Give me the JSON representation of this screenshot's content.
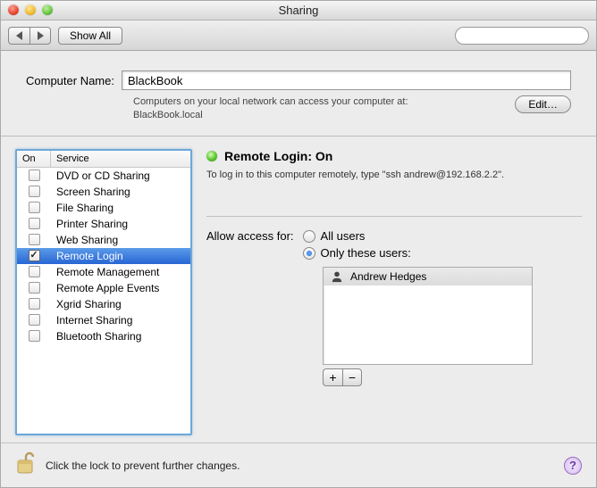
{
  "window": {
    "title": "Sharing"
  },
  "toolbar": {
    "show_all": "Show All",
    "search_placeholder": ""
  },
  "computer_name": {
    "label": "Computer Name:",
    "value": "BlackBook",
    "subtext_line1": "Computers on your local network can access your computer at:",
    "subtext_line2": "BlackBook.local",
    "edit": "Edit…"
  },
  "services": {
    "header_on": "On",
    "header_service": "Service",
    "items": [
      {
        "label": "DVD or CD Sharing",
        "on": false,
        "selected": false
      },
      {
        "label": "Screen Sharing",
        "on": false,
        "selected": false
      },
      {
        "label": "File Sharing",
        "on": false,
        "selected": false
      },
      {
        "label": "Printer Sharing",
        "on": false,
        "selected": false
      },
      {
        "label": "Web Sharing",
        "on": false,
        "selected": false
      },
      {
        "label": "Remote Login",
        "on": true,
        "selected": true
      },
      {
        "label": "Remote Management",
        "on": false,
        "selected": false
      },
      {
        "label": "Remote Apple Events",
        "on": false,
        "selected": false
      },
      {
        "label": "Xgrid Sharing",
        "on": false,
        "selected": false
      },
      {
        "label": "Internet Sharing",
        "on": false,
        "selected": false
      },
      {
        "label": "Bluetooth Sharing",
        "on": false,
        "selected": false
      }
    ]
  },
  "detail": {
    "status_title": "Remote Login: On",
    "status_desc": "To log in to this computer remotely, type \"ssh andrew@192.168.2.2\".",
    "access_label": "Allow access for:",
    "radio_all": "All users",
    "radio_only": "Only these users:",
    "users": [
      {
        "name": "Andrew Hedges"
      }
    ],
    "add": "+",
    "remove": "−"
  },
  "footer": {
    "text": "Click the lock to prevent further changes.",
    "help": "?"
  }
}
